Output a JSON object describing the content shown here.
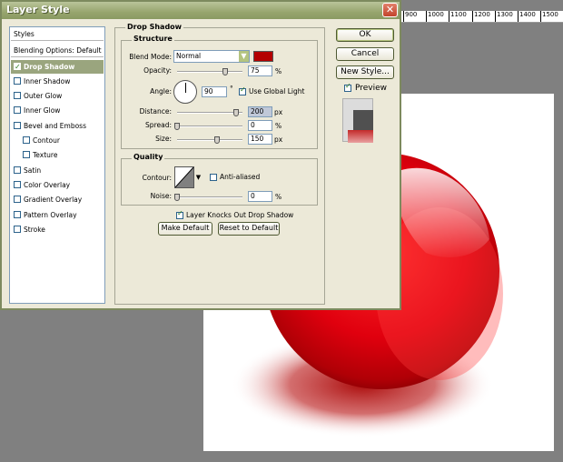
{
  "window": {
    "title": "Layer Style",
    "close_symbol": "✕"
  },
  "ruler": {
    "ticks": [
      "900",
      "1000",
      "1100",
      "1200",
      "1300",
      "1400",
      "1500"
    ]
  },
  "styles_list": {
    "header": "Styles",
    "blending_options": "Blending Options: Default",
    "items": [
      {
        "label": "Drop Shadow",
        "checked": true,
        "selected": true,
        "indent": false
      },
      {
        "label": "Inner Shadow",
        "checked": false,
        "selected": false,
        "indent": false
      },
      {
        "label": "Outer Glow",
        "checked": false,
        "selected": false,
        "indent": false
      },
      {
        "label": "Inner Glow",
        "checked": false,
        "selected": false,
        "indent": false
      },
      {
        "label": "Bevel and Emboss",
        "checked": false,
        "selected": false,
        "indent": false
      },
      {
        "label": "Contour",
        "checked": false,
        "selected": false,
        "indent": true
      },
      {
        "label": "Texture",
        "checked": false,
        "selected": false,
        "indent": true
      },
      {
        "label": "Satin",
        "checked": false,
        "selected": false,
        "indent": false
      },
      {
        "label": "Color Overlay",
        "checked": false,
        "selected": false,
        "indent": false
      },
      {
        "label": "Gradient Overlay",
        "checked": false,
        "selected": false,
        "indent": false
      },
      {
        "label": "Pattern Overlay",
        "checked": false,
        "selected": false,
        "indent": false
      },
      {
        "label": "Stroke",
        "checked": false,
        "selected": false,
        "indent": false
      }
    ]
  },
  "drop_shadow": {
    "title": "Drop Shadow",
    "structure": {
      "title": "Structure",
      "blend_mode_label": "Blend Mode:",
      "blend_mode_value": "Normal",
      "shadow_color": "#b40000",
      "opacity_label": "Opacity:",
      "opacity_value": "75",
      "opacity_unit": "%",
      "angle_label": "Angle:",
      "angle_value": "90",
      "angle_unit": "°",
      "use_global_light_label": "Use Global Light",
      "use_global_light": true,
      "distance_label": "Distance:",
      "distance_value": "200",
      "distance_unit": "px",
      "spread_label": "Spread:",
      "spread_value": "0",
      "spread_unit": "%",
      "size_label": "Size:",
      "size_value": "150",
      "size_unit": "px"
    },
    "quality": {
      "title": "Quality",
      "contour_label": "Contour:",
      "anti_aliased_label": "Anti-aliased",
      "anti_aliased": false,
      "noise_label": "Noise:",
      "noise_value": "0",
      "noise_unit": "%"
    },
    "knocks_out_label": "Layer Knocks Out Drop Shadow",
    "knocks_out": true,
    "make_default_label": "Make Default",
    "reset_default_label": "Reset to Default"
  },
  "buttons": {
    "ok": "OK",
    "cancel": "Cancel",
    "new_style": "New Style...",
    "preview_label": "Preview",
    "preview_checked": true
  },
  "colors": {
    "accent": "#9aa57e",
    "shadow": "#b40000",
    "ball": "#e0000e"
  },
  "icons": {
    "close": "close-icon",
    "dropdown": "chevron-down-icon",
    "angle": "angle-dial-icon",
    "contour": "contour-curve-icon"
  }
}
